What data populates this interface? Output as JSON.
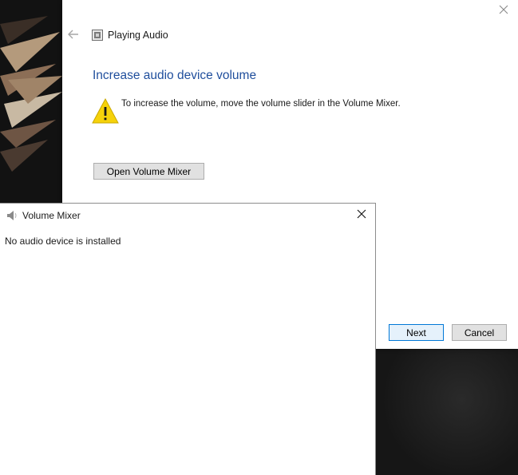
{
  "wizard": {
    "app_title": "Playing Audio",
    "heading": "Increase audio device volume",
    "instruction": "To increase the volume, move the volume slider in the Volume Mixer.",
    "open_mixer_label": "Open Volume Mixer",
    "next_label": "Next",
    "cancel_label": "Cancel",
    "icons": {
      "back": "back-arrow-icon",
      "close": "close-icon",
      "warning": "warning-icon",
      "app": "troubleshooter-icon"
    }
  },
  "mixer": {
    "title": "Volume Mixer",
    "message": "No audio device is installed",
    "icons": {
      "speaker": "speaker-icon",
      "close": "close-icon"
    }
  },
  "colors": {
    "heading_blue": "#1f4e9c",
    "warning_yellow": "#f6d20a",
    "primary_border": "#0078d7",
    "desktop_bg": "#151515"
  }
}
